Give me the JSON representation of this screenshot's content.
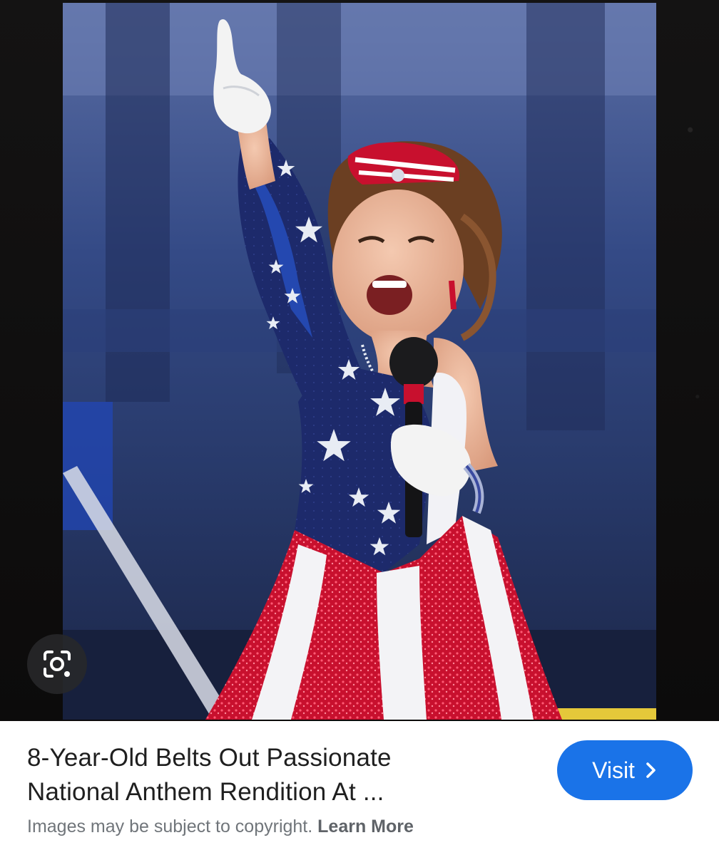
{
  "image_result": {
    "title_line_1": "8-Year-Old Belts Out Passionate",
    "title_line_2": "National Anthem Rendition At ...",
    "visit_label": "Visit",
    "copyright_notice": "Images may be subject to copyright.",
    "learn_more_label": "Learn More"
  },
  "icons": {
    "lens": "lens-search-icon",
    "visit_chevron": "chevron-right-icon"
  },
  "colors": {
    "visit_button_bg": "#1a73e8",
    "title_text": "#1f1f1f",
    "secondary_text": "#70757a",
    "viewer_background": "#0d0c0c"
  }
}
